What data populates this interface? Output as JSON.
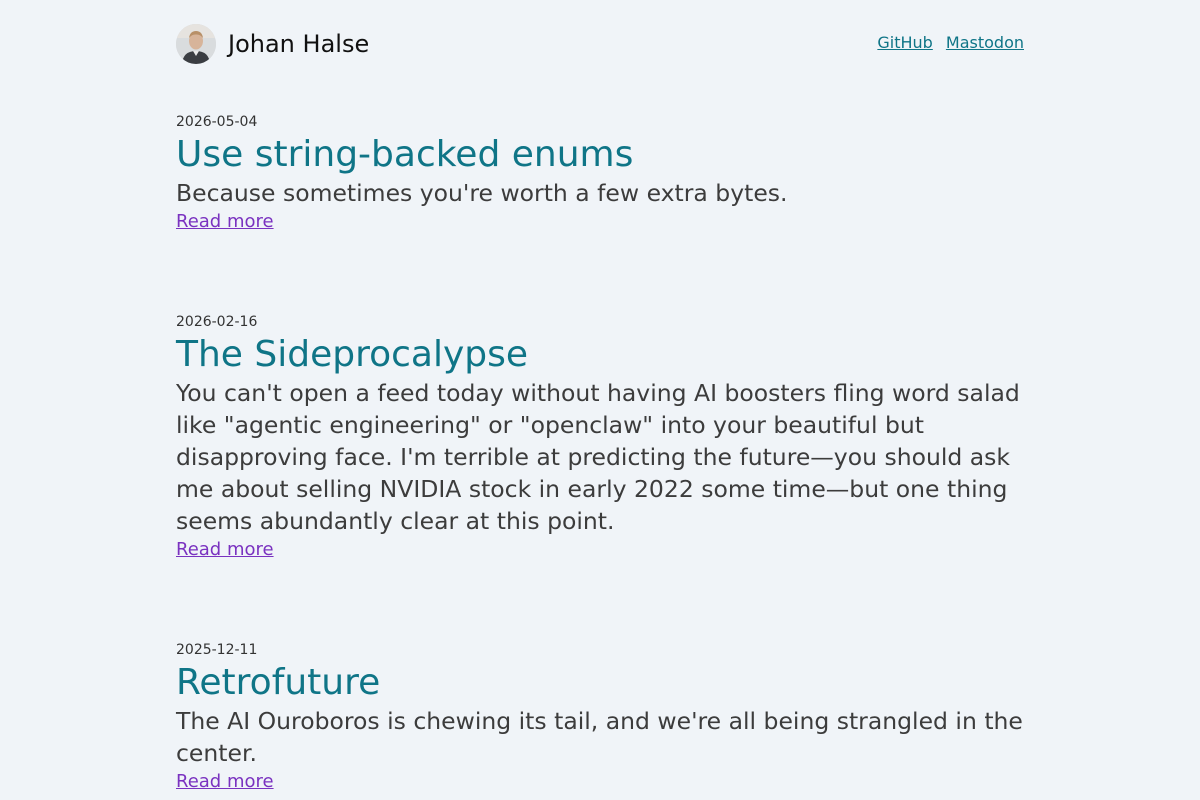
{
  "site": {
    "title": "Johan Halse"
  },
  "nav": {
    "links": [
      {
        "label": "GitHub"
      },
      {
        "label": "Mastodon"
      }
    ]
  },
  "posts": [
    {
      "date": "2026-05-04",
      "title": "Use string-backed enums",
      "excerpt": "Because sometimes you're worth a few extra bytes.",
      "read_more": "Read more"
    },
    {
      "date": "2026-02-16",
      "title": "The Sideprocalypse",
      "excerpt": "You can't open a feed today without having AI boosters fling word salad like \"agentic engineering\" or \"openclaw\" into your beautiful but disapproving face. I'm terrible at predicting the future—you should ask me about selling NVIDIA stock in early 2022 some time—but one thing seems abundantly clear at this point.",
      "read_more": "Read more"
    },
    {
      "date": "2025-12-11",
      "title": "Retrofuture",
      "excerpt": "The AI Ouroboros is chewing its tail, and we're all being strangled in the center.",
      "read_more": "Read more"
    }
  ],
  "colors": {
    "background": "#f0f4f8",
    "title_link": "#0f7587",
    "read_more": "#7a32c0",
    "text": "#3c3c3c"
  }
}
